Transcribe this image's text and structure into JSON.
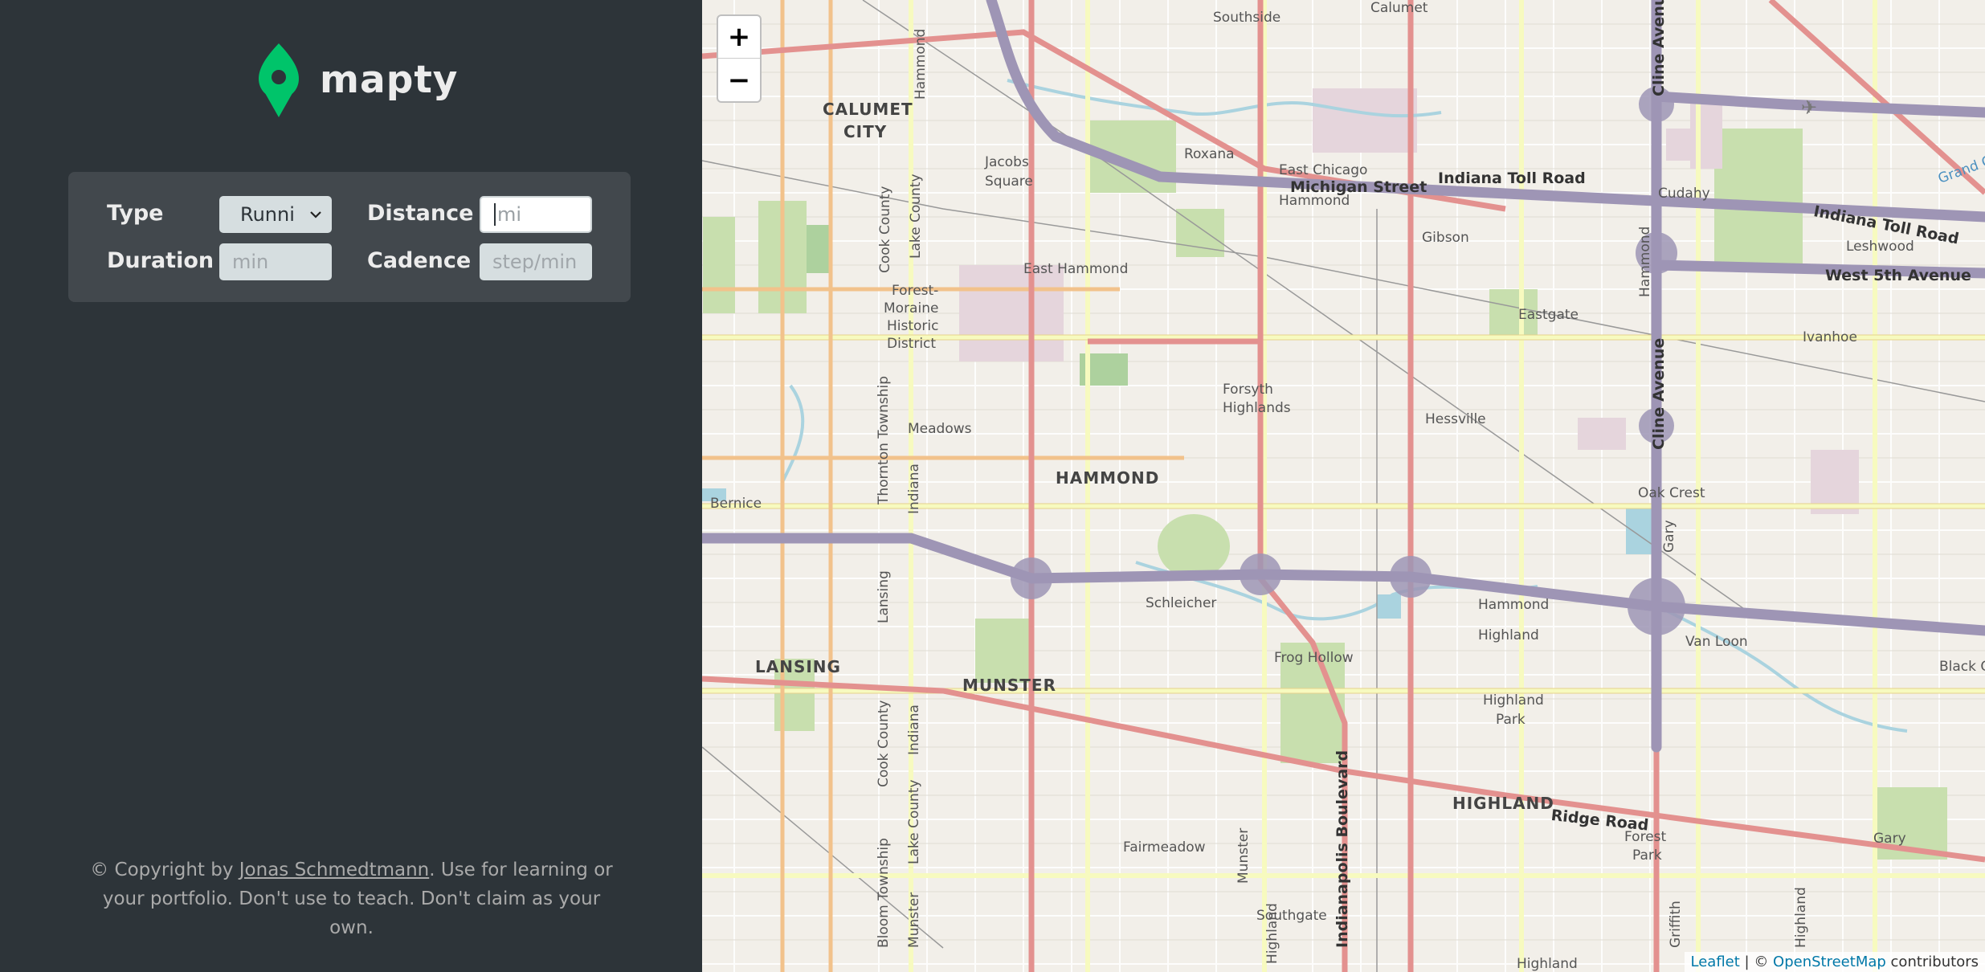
{
  "app": {
    "name": "mapty"
  },
  "form": {
    "type_label": "Type",
    "type_value": "Runni",
    "distance_label": "Distance",
    "distance_placeholder": "mi",
    "duration_label": "Duration",
    "duration_placeholder": "min",
    "cadence_label": "Cadence",
    "cadence_placeholder": "step/min"
  },
  "footer": {
    "prefix": "© Copyright by ",
    "author": "Jonas Schmedtmann",
    "suffix": ". Use for learning or your portfolio. Don't use to teach. Don't claim as your own."
  },
  "map": {
    "zoom_in": "+",
    "zoom_out": "−",
    "attribution_leaflet": "Leaflet",
    "attribution_sep": " | © ",
    "attribution_osm": "OpenStreetMap",
    "attribution_tail": " contributors",
    "labels": {
      "southside": "Southside",
      "calumet": "Calumet",
      "hammond_top": "Hammond",
      "calumet_city_1": "CALUMET",
      "calumet_city_2": "CITY",
      "jacobs_1": "Jacobs",
      "jacobs_2": "Square",
      "roxana": "Roxana",
      "east_chicago": "East Chicago",
      "michigan_street": "Michigan Street",
      "hammond_mid": "Hammond",
      "indiana_toll_1": "Indiana Toll Road",
      "indiana_toll_2": "Indiana Toll Road",
      "cudahy": "Cudahy",
      "leshwood": "Leshwood",
      "gibson": "Gibson",
      "west_5th": "West 5th Avenue",
      "grand_cal": "Grand Cal",
      "cline_top": "Cline Avenue",
      "cline_mid": "Cline Avenue",
      "hammond_v": "Hammond",
      "east_hammond": "East Hammond",
      "eastgate": "Eastgate",
      "ivanhoe": "Ivanhoe",
      "forest_1": "Forest-",
      "forest_2": "Moraine",
      "forest_3": "Historic",
      "forest_4": "District",
      "forsyth_1": "Forsyth",
      "forsyth_2": "Highlands",
      "hessville": "Hessville",
      "meadows": "Meadows",
      "hammond_city": "HAMMOND",
      "oak_crest": "Oak Crest",
      "bernice": "Bernice",
      "schleicher": "Schleicher",
      "hammond_high_1": "Hammond",
      "hammond_high_2": "Highland",
      "van_loon": "Van Loon",
      "frog_hollow": "Frog Hollow",
      "lansing": "LANSING",
      "munster": "MUNSTER",
      "highland_park_1": "Highland",
      "highland_park_2": "Park",
      "highland_city": "HIGHLAND",
      "ridge_road": "Ridge Road",
      "forest_park_1": "Forest",
      "forest_park_2": "Park",
      "gary": "Gary",
      "fairmeadow": "Fairmeadow",
      "southgate": "Southgate",
      "highland_bot": "Highland",
      "black_oak": "Black O",
      "cook_county_1": "Cook County",
      "lake_county_1": "Lake County",
      "thornton": "Thornton Township",
      "indiana_v": "Indiana",
      "lansing_v": "Lansing",
      "cook_county_2": "Cook County",
      "indiana_v2": "Indiana",
      "lake_county_2": "Lake County",
      "bloom": "Bloom Township",
      "munster_v": "Munster",
      "munster_v2": "Munster",
      "highland_v": "Highland",
      "indianapolis": "Indianapolis Boulevard",
      "gary_v": "Gary",
      "griffith": "Griffith",
      "highland_v2": "Highland"
    }
  }
}
